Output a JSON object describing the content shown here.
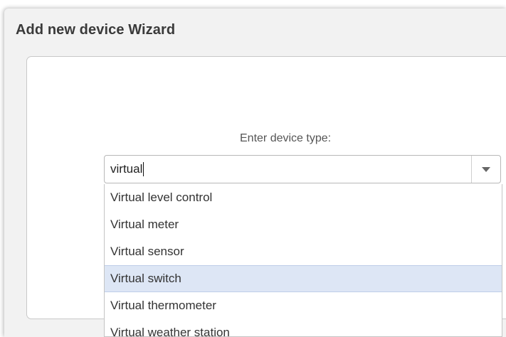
{
  "wizard": {
    "title": "Add new device Wizard",
    "device_type_label": "Enter device type:"
  },
  "device_type_input": {
    "value": "virtual"
  },
  "toggle_icon": "chevron-down-icon",
  "dropdown": {
    "options": [
      "Virtual level control",
      "Virtual meter",
      "Virtual sensor",
      "Virtual switch",
      "Virtual thermometer",
      "Virtual weather station"
    ],
    "highlighted_option": "Virtual switch"
  },
  "colors": {
    "panel_background": "#f2f2f2",
    "highlight_background": "#dde6f5",
    "text": "#333333"
  }
}
